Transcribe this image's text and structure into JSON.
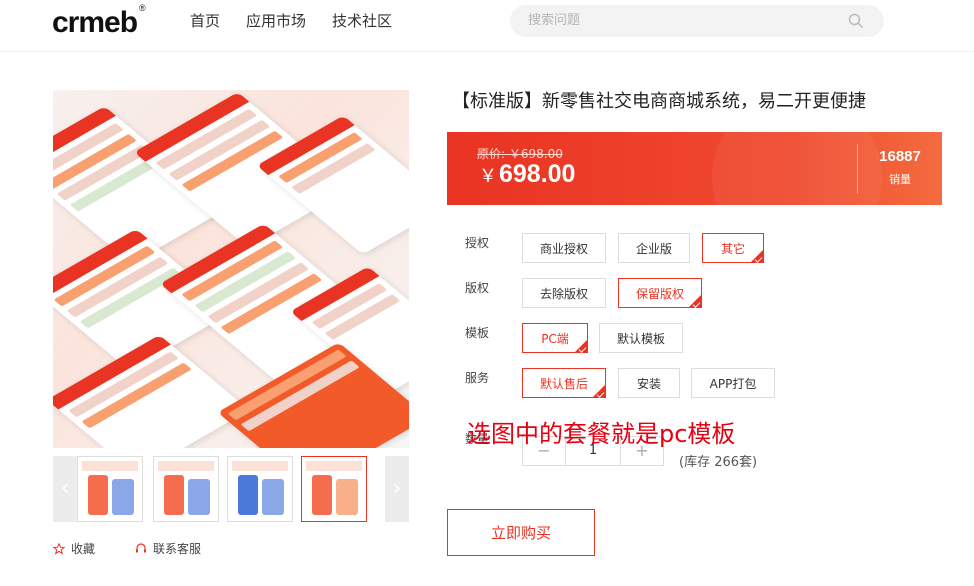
{
  "header": {
    "logo": "crmeb",
    "logo_mark": "®",
    "nav": [
      "首页",
      "应用市场",
      "技术社区"
    ],
    "search_placeholder": "搜索问题"
  },
  "product": {
    "title": "【标准版】新零售社交电商商城系统，易二开更便捷",
    "original_price": "原价: ￥698.00",
    "currency": "￥",
    "price": "698.00",
    "sales_count": "16887",
    "sales_label": "销量"
  },
  "options": [
    {
      "label": "授权",
      "values": [
        "商业授权",
        "企业版",
        "其它"
      ],
      "selected": "其它"
    },
    {
      "label": "版权",
      "values": [
        "去除版权",
        "保留版权"
      ],
      "selected": "保留版权"
    },
    {
      "label": "模板",
      "values": [
        "PC端",
        "默认模板"
      ],
      "selected": "PC端"
    },
    {
      "label": "服务",
      "values": [
        "默认售后",
        "安装",
        "APP打包"
      ],
      "selected": "默认售后"
    }
  ],
  "quantity": {
    "label": "数量",
    "minus": "−",
    "value": "1",
    "plus": "+",
    "stock": "(库存 266套)"
  },
  "annotation": "选图中的套餐就是pc模板",
  "buy_button": "立即购买",
  "actions": {
    "favorite": "收藏",
    "service": "联系客服"
  },
  "gallery": {
    "prev": "‹",
    "next": "›",
    "active_index": 3
  },
  "colors": {
    "accent": "#e93323",
    "annotation": "#e60012"
  }
}
